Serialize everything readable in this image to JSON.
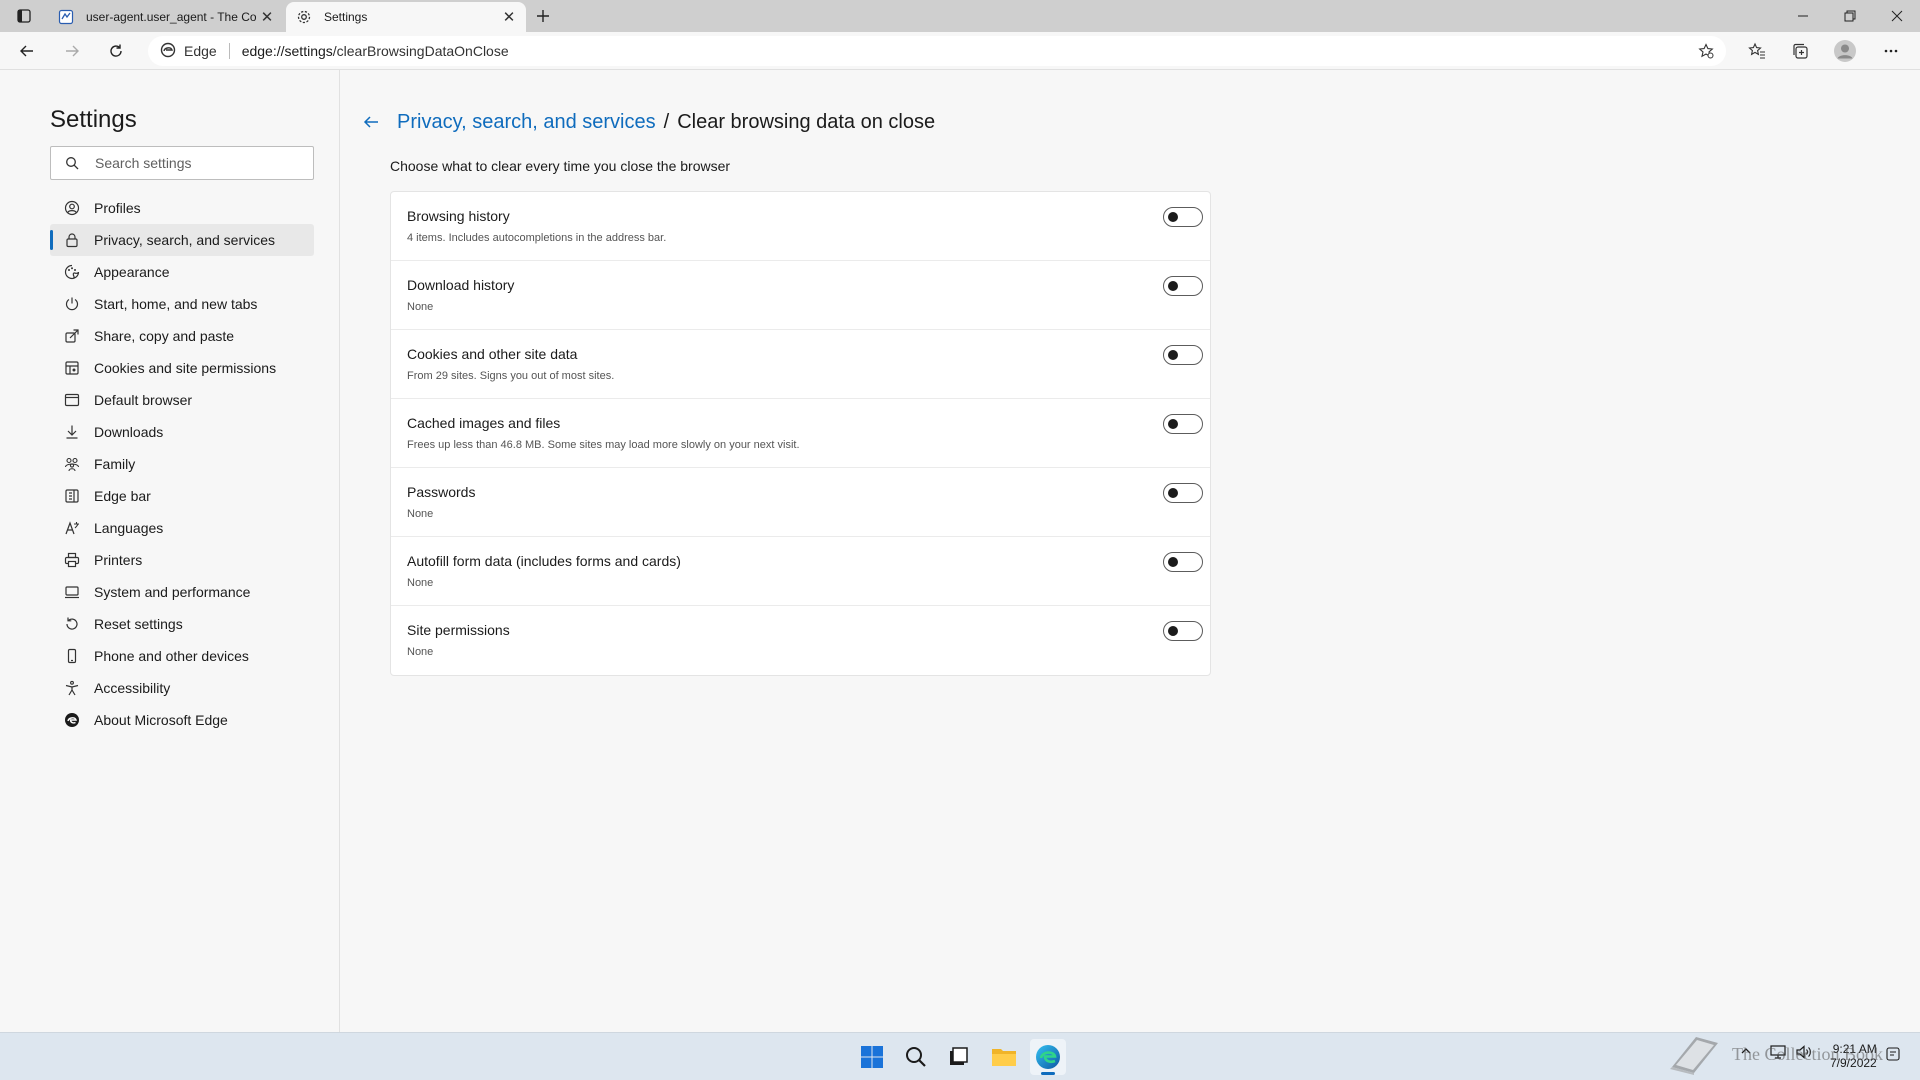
{
  "browser": {
    "tabs": [
      {
        "title": "user-agent.user_agent - The Coll",
        "icon": "web-page-icon"
      },
      {
        "title": "Settings",
        "icon": "gear-icon"
      }
    ],
    "address": {
      "badge": "Edge",
      "url_host": "edge://settings",
      "url_path": "/clearBrowsingDataOnClose"
    }
  },
  "sidebar": {
    "title": "Settings",
    "search_placeholder": "Search settings",
    "items": [
      {
        "label": "Profiles",
        "icon": "profile-icon"
      },
      {
        "label": "Privacy, search, and services",
        "icon": "lock-icon",
        "selected": true
      },
      {
        "label": "Appearance",
        "icon": "appearance-icon"
      },
      {
        "label": "Start, home, and new tabs",
        "icon": "power-icon"
      },
      {
        "label": "Share, copy and paste",
        "icon": "share-icon"
      },
      {
        "label": "Cookies and site permissions",
        "icon": "cookies-icon"
      },
      {
        "label": "Default browser",
        "icon": "browser-icon"
      },
      {
        "label": "Downloads",
        "icon": "download-icon"
      },
      {
        "label": "Family",
        "icon": "family-icon"
      },
      {
        "label": "Edge bar",
        "icon": "edge-bar-icon"
      },
      {
        "label": "Languages",
        "icon": "languages-icon"
      },
      {
        "label": "Printers",
        "icon": "printer-icon"
      },
      {
        "label": "System and performance",
        "icon": "system-icon"
      },
      {
        "label": "Reset settings",
        "icon": "reset-icon"
      },
      {
        "label": "Phone and other devices",
        "icon": "phone-icon"
      },
      {
        "label": "Accessibility",
        "icon": "accessibility-icon"
      },
      {
        "label": "About Microsoft Edge",
        "icon": "edge-logo-icon"
      }
    ]
  },
  "main": {
    "breadcrumb_parent": "Privacy, search, and services",
    "breadcrumb_separator": "/",
    "breadcrumb_current": "Clear browsing data on close",
    "description": "Choose what to clear every time you close the browser",
    "options": [
      {
        "title": "Browsing history",
        "subtitle": "4 items. Includes autocompletions in the address bar.",
        "enabled": false
      },
      {
        "title": "Download history",
        "subtitle": "None",
        "enabled": false
      },
      {
        "title": "Cookies and other site data",
        "subtitle": "From 29 sites. Signs you out of most sites.",
        "enabled": false
      },
      {
        "title": "Cached images and files",
        "subtitle": "Frees up less than 46.8 MB. Some sites may load more slowly on your next visit.",
        "enabled": false
      },
      {
        "title": "Passwords",
        "subtitle": "None",
        "enabled": false
      },
      {
        "title": "Autofill form data (includes forms and cards)",
        "subtitle": "None",
        "enabled": false
      },
      {
        "title": "Site permissions",
        "subtitle": "None",
        "enabled": false
      }
    ]
  },
  "taskbar": {
    "time": "9:21 AM",
    "date": "7/9/2022",
    "watermark": "The Collection Book"
  },
  "colors": {
    "accent": "#0f6cbd",
    "taskbar": "#dde6ef",
    "tabbar": "#cfcfcf"
  }
}
